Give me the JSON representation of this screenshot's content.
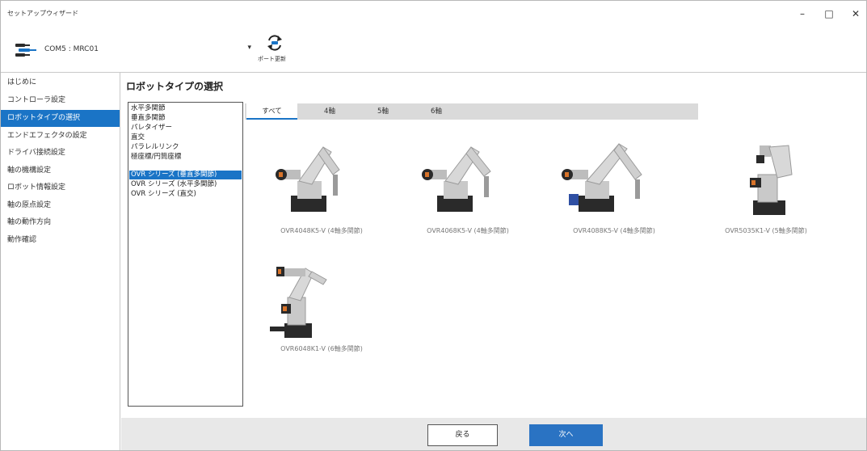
{
  "window": {
    "title": "セットアップウィザード",
    "minimize_icon": "minimize-icon",
    "maximize_icon": "maximize-icon",
    "close_icon": "close-icon"
  },
  "toolbar": {
    "port_value": "COM5 : MRC01",
    "port_icon": "connection-plug-icon",
    "refresh_label": "ポート更新",
    "refresh_icon": "refresh-arrows-icon"
  },
  "sidebar": {
    "items": [
      {
        "label": "はじめに",
        "active": false
      },
      {
        "label": "コントローラ設定",
        "active": false
      },
      {
        "label": "ロボットタイプの選択",
        "active": true
      },
      {
        "label": "エンドエフェクタの設定",
        "active": false
      },
      {
        "label": "ドライバ接続設定",
        "active": false
      },
      {
        "label": "軸の機構設定",
        "active": false
      },
      {
        "label": "ロボット情報設定",
        "active": false
      },
      {
        "label": "軸の原点設定",
        "active": false
      },
      {
        "label": "軸の動作方向",
        "active": false
      },
      {
        "label": "動作確認",
        "active": false
      }
    ]
  },
  "main": {
    "heading": "ロボットタイプの選択",
    "robot_types": [
      {
        "label": "水平多関節",
        "active": false
      },
      {
        "label": "垂直多関節",
        "active": false
      },
      {
        "label": "パレタイザー",
        "active": false
      },
      {
        "label": "直交",
        "active": false
      },
      {
        "label": "パラレルリンク",
        "active": false
      },
      {
        "label": "極座標/円筒座標",
        "active": false
      },
      {
        "label": "OVR シリーズ (垂直多関節)",
        "active": true
      },
      {
        "label": "OVR シリーズ (水平多関節)",
        "active": false
      },
      {
        "label": "OVR シリーズ (直交)",
        "active": false
      }
    ],
    "tabs": [
      {
        "label": "すべて",
        "active": true
      },
      {
        "label": "4軸",
        "active": false
      },
      {
        "label": "5軸",
        "active": false
      },
      {
        "label": "6軸",
        "active": false
      }
    ],
    "robots": [
      {
        "label": "OVR4048K5-V (4軸多関節)",
        "icon": "robot-arm-4axis-icon"
      },
      {
        "label": "OVR4068K5-V (4軸多関節)",
        "icon": "robot-arm-4axis-icon"
      },
      {
        "label": "OVR4088K5-V (4軸多関節)",
        "icon": "robot-arm-4axis-icon"
      },
      {
        "label": "OVR5035K1-V (5軸多関節)",
        "icon": "robot-arm-5axis-icon"
      },
      {
        "label": "OVR6048K1-V (6軸多関節)",
        "icon": "robot-arm-6axis-icon"
      }
    ]
  },
  "footer": {
    "back_label": "戻る",
    "next_label": "次へ"
  },
  "colors": {
    "accent": "#1a74c6",
    "next_button": "#2a73c3",
    "footer_bg": "#e8e8e8",
    "tabbar_bg": "#dadada"
  }
}
